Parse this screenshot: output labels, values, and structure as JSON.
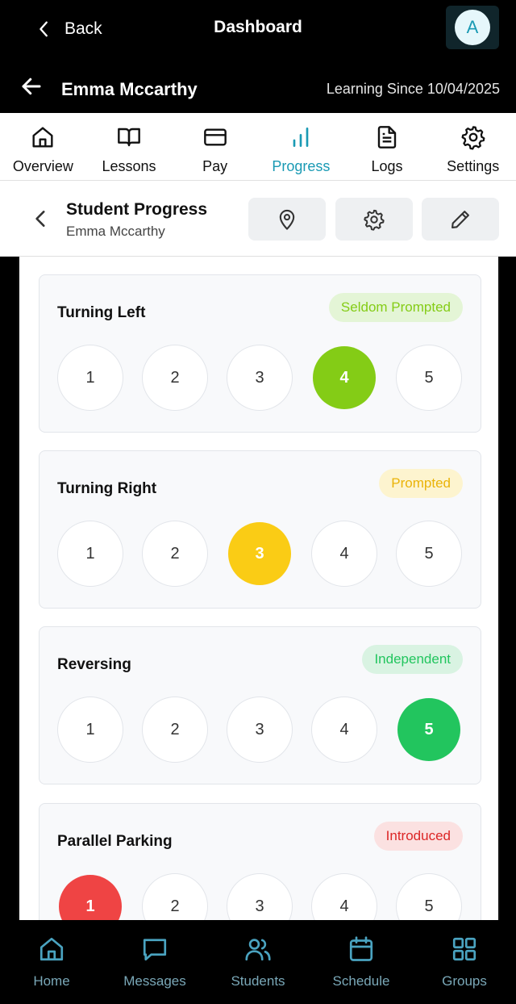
{
  "topbar": {
    "back_label": "Back",
    "title": "Dashboard",
    "avatar_initial": "A"
  },
  "student": {
    "name": "Emma Mccarthy",
    "learning_since": "Learning Since 10/04/2025"
  },
  "tabs": [
    {
      "label": "Overview",
      "icon": "home-icon"
    },
    {
      "label": "Lessons",
      "icon": "book-icon"
    },
    {
      "label": "Pay",
      "icon": "card-icon"
    },
    {
      "label": "Progress",
      "icon": "bar-chart-icon",
      "active": true
    },
    {
      "label": "Logs",
      "icon": "document-icon"
    },
    {
      "label": "Settings",
      "icon": "gear-icon"
    }
  ],
  "header": {
    "title": "Student Progress",
    "subtitle": "Emma Mccarthy"
  },
  "skills": [
    {
      "title": "Turning Left",
      "status": "Seldom Prompted",
      "selected": 4,
      "color": "#84cc16",
      "badge_bg": "#e4f5d6",
      "badge_fg": "#84cc16"
    },
    {
      "title": "Turning Right",
      "status": "Prompted",
      "selected": 3,
      "color": "#facc15",
      "badge_bg": "#fdf4cf",
      "badge_fg": "#eab308"
    },
    {
      "title": "Reversing",
      "status": "Independent",
      "selected": 5,
      "color": "#22c55e",
      "badge_bg": "#d9f3e2",
      "badge_fg": "#22c55e"
    },
    {
      "title": "Parallel Parking",
      "status": "Introduced",
      "selected": 1,
      "color": "#ef4444",
      "badge_bg": "#fbe1e1",
      "badge_fg": "#dc2626"
    }
  ],
  "ratings": [
    "1",
    "2",
    "3",
    "4",
    "5"
  ],
  "bottom_nav": [
    {
      "label": "Home",
      "icon": "home-icon"
    },
    {
      "label": "Messages",
      "icon": "chat-icon"
    },
    {
      "label": "Students",
      "icon": "users-icon"
    },
    {
      "label": "Schedule",
      "icon": "calendar-icon"
    },
    {
      "label": "Groups",
      "icon": "grid-icon"
    }
  ]
}
